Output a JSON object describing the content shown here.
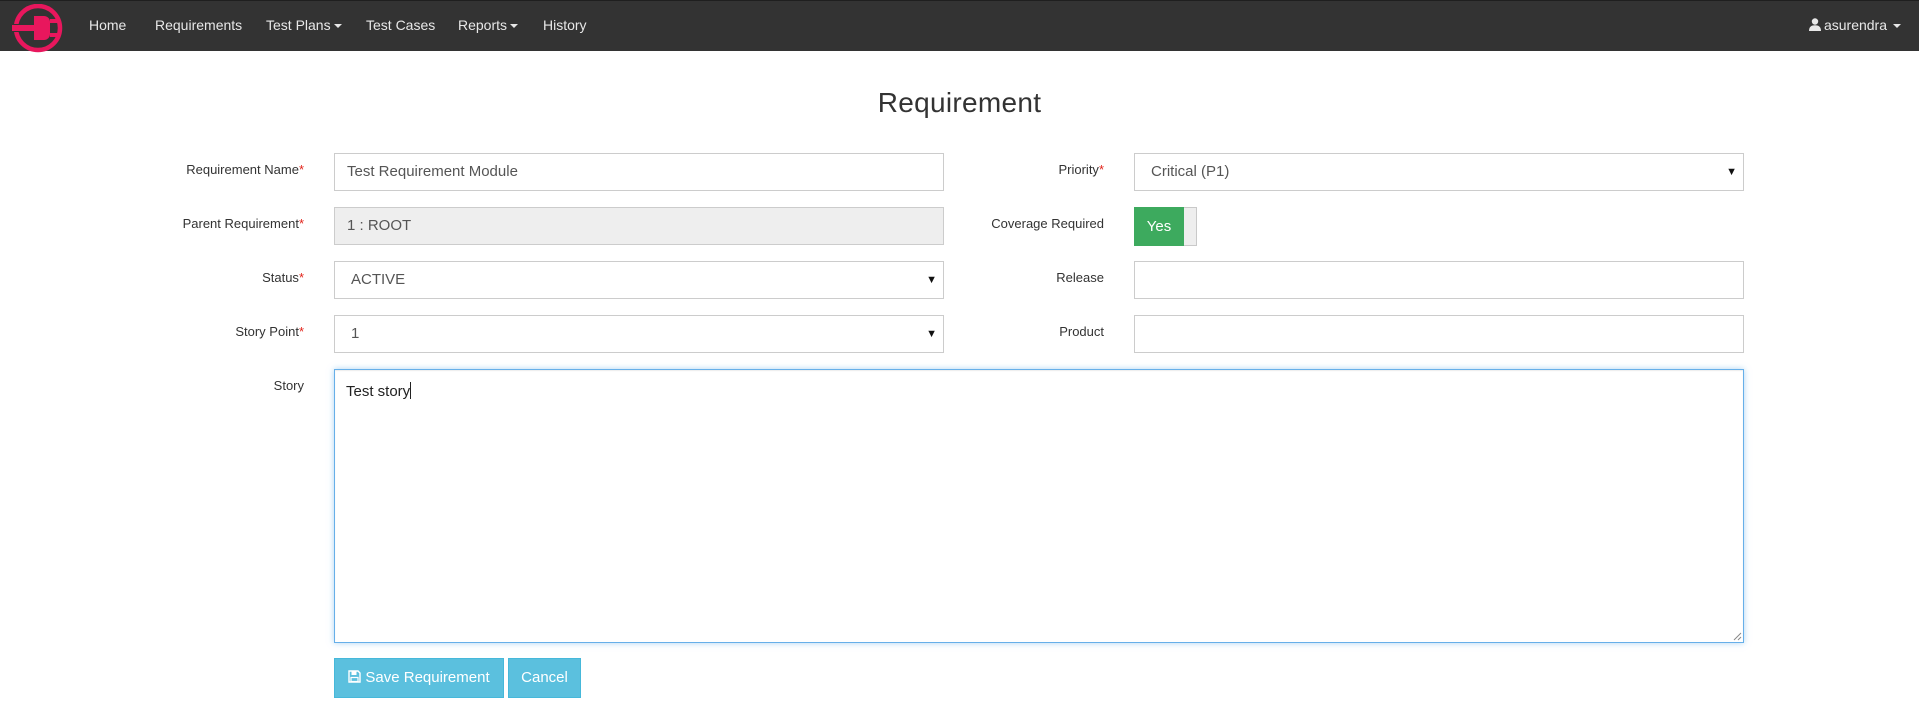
{
  "nav": {
    "items": [
      {
        "label": "Home",
        "dropdown": false
      },
      {
        "label": "Requirements",
        "dropdown": false
      },
      {
        "label": "Test Plans",
        "dropdown": true
      },
      {
        "label": "Test Cases",
        "dropdown": false
      },
      {
        "label": "Reports",
        "dropdown": true
      },
      {
        "label": "History",
        "dropdown": false
      }
    ],
    "user": "asurendra"
  },
  "page": {
    "title": "Requirement"
  },
  "form": {
    "requirement_name": {
      "label": "Requirement Name",
      "value": "Test Requirement Module"
    },
    "parent_requirement": {
      "label": "Parent Requirement",
      "value": "1 :  ROOT"
    },
    "status": {
      "label": "Status",
      "value": "ACTIVE"
    },
    "story_point": {
      "label": "Story Point",
      "value": "1"
    },
    "story": {
      "label": "Story",
      "value": "Test story"
    },
    "priority": {
      "label": "Priority",
      "value": "Critical (P1)"
    },
    "coverage_required": {
      "label": "Coverage Required",
      "value": "Yes"
    },
    "release": {
      "label": "Release",
      "value": ""
    },
    "product": {
      "label": "Product",
      "value": ""
    },
    "required_marker": "*"
  },
  "actions": {
    "save_label": "Save Requirement",
    "cancel_label": "Cancel"
  },
  "colors": {
    "navbar": "#333333",
    "logo": "#e8175d",
    "toggle_on": "#3daa5e",
    "button_info": "#5bc0de",
    "required": "#e2231a"
  },
  "icons": {
    "logo": "plug-logo-icon",
    "user": "user-icon",
    "save": "floppy-disk-icon",
    "dropdown": "caret-down-icon"
  }
}
